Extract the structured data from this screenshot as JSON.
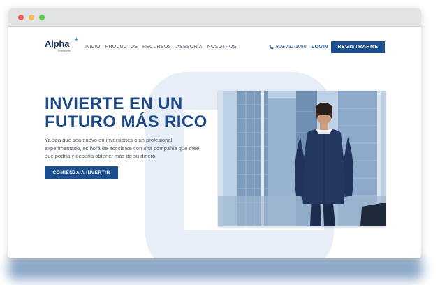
{
  "window": {
    "controls": [
      "close",
      "minimize",
      "maximize"
    ]
  },
  "brand": {
    "name": "Alpha",
    "plus": "+",
    "sub": "Inversiones"
  },
  "nav": {
    "items": [
      "INICIO",
      "PRODUCTOS",
      "RECURSOS",
      "ASESORÍA",
      "NOSOTROS"
    ]
  },
  "header": {
    "phone": "809-732-1080",
    "login": "LOGIN",
    "register": "REGISTRARME"
  },
  "hero": {
    "title_line1": "INVIERTE EN UN",
    "title_line2": "FUTURO MÁS RICO",
    "body": "Ya sea que sea nuevo en inversiones o un profesional experimentado, es hora de asociarse con una compañía que cree que podría y debería obtener más de su dinero.",
    "cta": "COMIENZA A INVERTIR"
  },
  "colors": {
    "primary": "#1d4f8f",
    "title": "#1b4a86",
    "accent_plus": "#1f8fd6",
    "decor": "#e7eef8",
    "shadow": "#2a5d9c"
  },
  "icons": {
    "phone": "phone-icon"
  }
}
